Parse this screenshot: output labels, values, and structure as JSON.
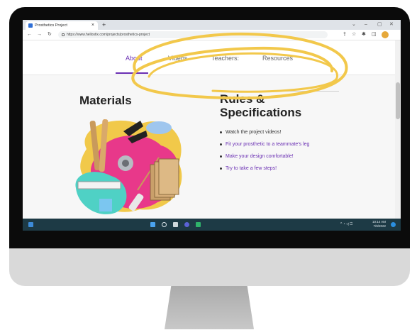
{
  "browser": {
    "tab_title": "Prosthetics Project",
    "tab_close": "×",
    "new_tab": "+",
    "url": "https://www.hellostix.com/projects/prosthetics-project",
    "window_controls": [
      "⌄",
      "–",
      "▢",
      "✕"
    ],
    "nav": {
      "back": "←",
      "forward": "→",
      "reload": "↻"
    },
    "toolbar_icons": [
      "⇪",
      "☆",
      "✱",
      "◫"
    ]
  },
  "site_nav": {
    "items": [
      {
        "label": "About",
        "active": true
      },
      {
        "label": "Videos"
      },
      {
        "label": "Teachers:"
      },
      {
        "label": "Resources"
      }
    ]
  },
  "content": {
    "materials_heading": "Materials",
    "rules_heading_line1": "Rules &",
    "rules_heading_line2": "Specifications",
    "rules": [
      "Watch the project videos!",
      "Fit your prosthetic to a teammate's leg",
      "Make your design comfortable!",
      "Try to take a few steps!"
    ]
  },
  "taskbar": {
    "time": "10:14 AM",
    "date": "7/9/2022",
    "tray": "^ ◔ ◁ ⏍"
  },
  "colors": {
    "accent": "#6a2fb3",
    "highlight": "#f2c84b",
    "taskbar": "#1d3a45"
  }
}
